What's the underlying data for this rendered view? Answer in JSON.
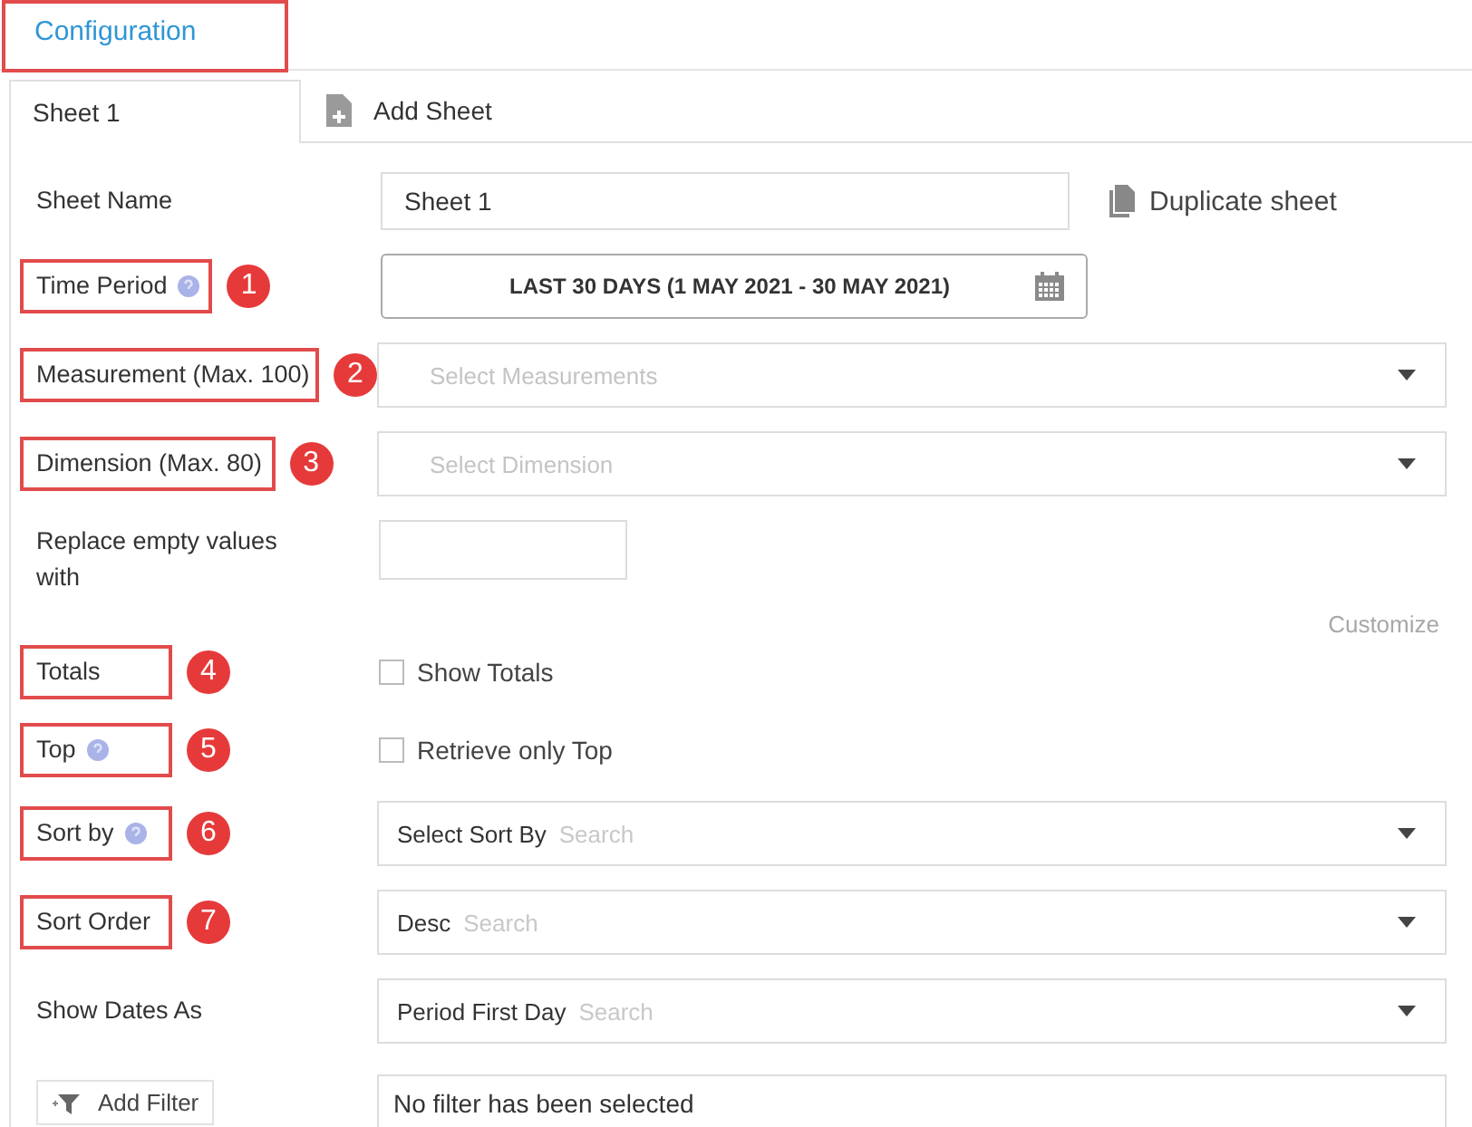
{
  "header": {
    "title": "Configuration",
    "highlighted": true
  },
  "tabs": [
    {
      "label": "Sheet 1",
      "selected": true,
      "kind": "sheet"
    },
    {
      "label": "Add Sheet",
      "selected": false,
      "kind": "add"
    }
  ],
  "rows": [
    {
      "label": "Sheet Name",
      "highlighted": false,
      "kind": "text",
      "value": "Sheet 1",
      "action": "Duplicate sheet"
    },
    {
      "label": "Time Period",
      "highlighted": true,
      "help": true,
      "badge": "1",
      "kind": "daterange",
      "value": "LAST 30 DAYS (1 MAY 2021 - 30 MAY 2021)"
    },
    {
      "label": "Measurement (Max. 100)",
      "highlighted": true,
      "badge": "2",
      "kind": "select",
      "placeholder": "Select Measurements"
    },
    {
      "label": "Dimension (Max. 80)",
      "highlighted": true,
      "badge": "3",
      "kind": "select",
      "placeholder": "Select Dimension"
    },
    {
      "label": "Replace empty values with",
      "highlighted": false,
      "kind": "short",
      "link": "Customize"
    },
    {
      "label": "Totals",
      "highlighted": true,
      "badge": "4",
      "kind": "checkbox",
      "option": "Show Totals",
      "checked": false
    },
    {
      "label": "Top",
      "highlighted": true,
      "help": true,
      "badge": "5",
      "kind": "checkbox",
      "option": "Retrieve only Top",
      "checked": false
    },
    {
      "label": "Sort by",
      "highlighted": true,
      "help": true,
      "badge": "6",
      "kind": "select",
      "value": "Select Sort By",
      "search": "Search"
    },
    {
      "label": "Sort Order",
      "highlighted": true,
      "badge": "7",
      "kind": "select",
      "value": "Desc",
      "search": "Search"
    },
    {
      "label": "Show Dates As",
      "highlighted": false,
      "kind": "select",
      "value": "Period First Day",
      "search": "Search"
    },
    {
      "button": "Add Filter",
      "kind": "filter",
      "value": "No filter has been selected"
    }
  ]
}
